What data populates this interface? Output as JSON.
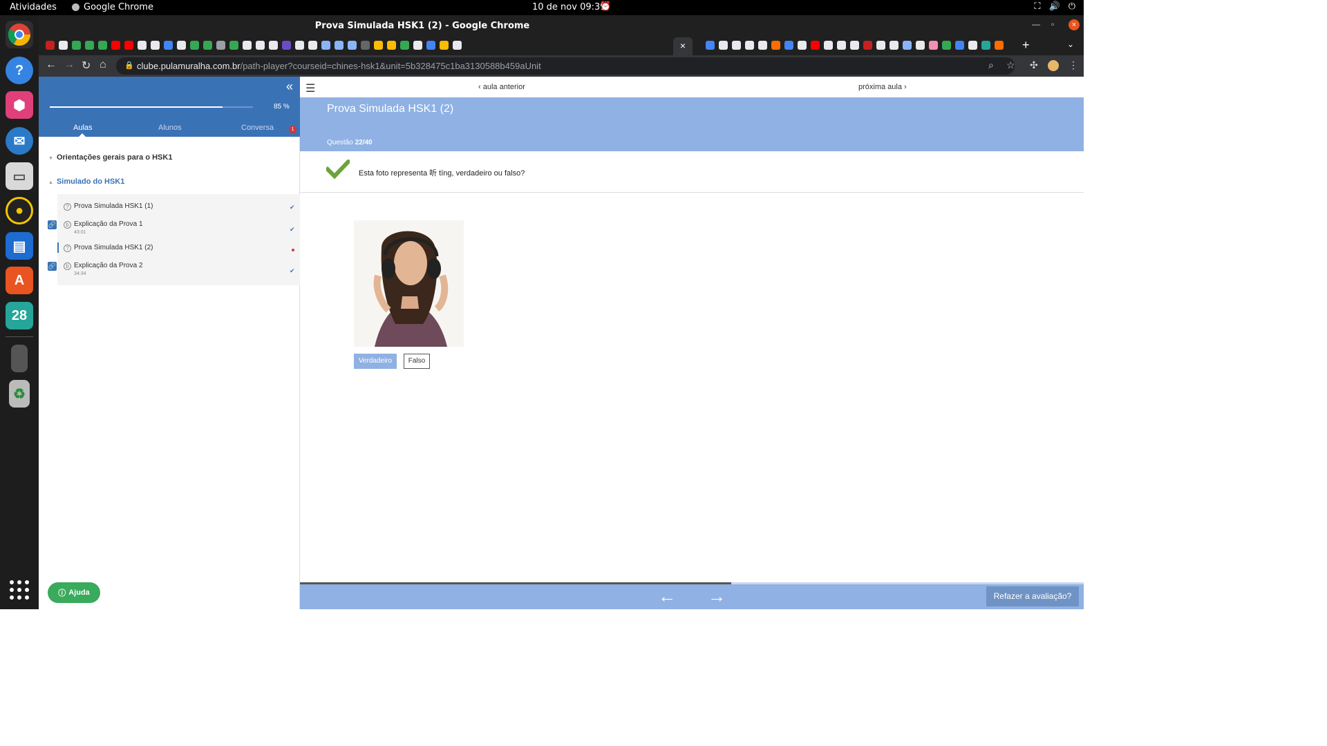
{
  "system": {
    "activities": "Atividades",
    "app_name": "Google Chrome",
    "clock": "10 de nov  09:39",
    "dock_calendar": "28"
  },
  "window": {
    "title": "Prova Simulada HSK1 (2) - Google Chrome",
    "close_glyph": "×"
  },
  "browser": {
    "url_host": "clube.pulamuralha.com.br",
    "url_path": "/path-player?courseid=chines-hsk1&unit=5b328475c1ba3130588b459aUnit",
    "tab_close": "×",
    "new_tab": "+"
  },
  "sidebar": {
    "progress_percent": 85,
    "progress_label": "85 %",
    "tabs": [
      "Aulas",
      "Alunos",
      "Conversa"
    ],
    "badge": "1",
    "sections": [
      "Orientações gerais para o HSK1",
      "Simulado do HSK1"
    ],
    "lessons": [
      {
        "name": "Prova Simulada HSK1 (1)",
        "duration": "",
        "icon": "?",
        "status": "done"
      },
      {
        "name": "Explicação da Prova 1",
        "duration": "43:01",
        "icon": "b",
        "status": "done"
      },
      {
        "name": "Prova Simulada HSK1 (2)",
        "duration": "",
        "icon": "?",
        "status": "current"
      },
      {
        "name": "Explicação da Prova 2",
        "duration": "34:34",
        "icon": "b",
        "status": "done"
      }
    ],
    "help_label": "Ajuda"
  },
  "main": {
    "prev_label": "aula anterior",
    "next_label": "próxima aula",
    "title": "Prova Simulada HSK1 (2)",
    "question_label": "Questão",
    "question_number": "22/40",
    "question_text": "Esta foto representa 听 tīng, verdadeiro ou falso?",
    "true_label": "Verdadeiro",
    "false_label": "Falso",
    "redo_label": "Refazer a avaliação?",
    "progress_fraction": 0.55
  },
  "colors": {
    "brand_blue": "#3a72b6",
    "banner_blue": "#8fb1e3",
    "check_green": "#6aa43a",
    "help_green": "#3aaa5c",
    "alert_red": "#d0383d"
  }
}
